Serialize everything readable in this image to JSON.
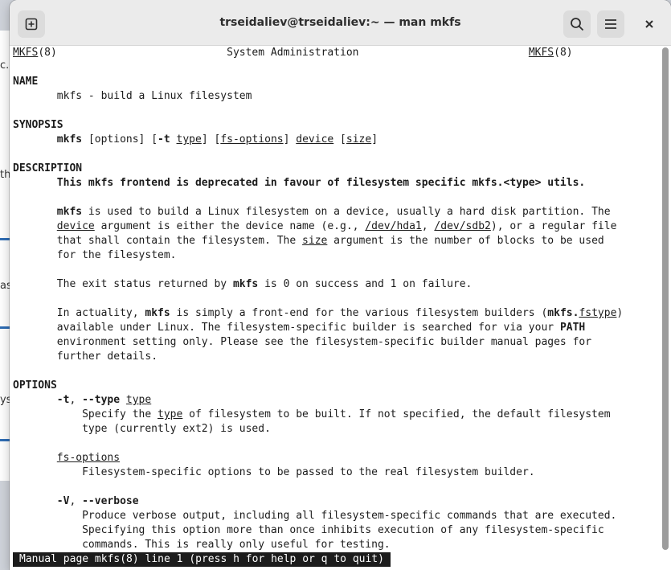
{
  "window": {
    "title": "trseidaliev@trseidaliev:~ — man mkfs"
  },
  "background_fragments": [
    "c.",
    "th",
    "as",
    "ys"
  ],
  "icons": {
    "new_tab": "new-tab-icon",
    "search": "search-icon",
    "menu": "hamburger-menu-icon",
    "close": "close-icon"
  },
  "man": {
    "header_left": "MKFS",
    "header_left_section": "(8)",
    "header_center": "System Administration",
    "header_right": "MKFS",
    "header_right_section": "(8)",
    "name_heading": "NAME",
    "name_text": "mkfs - build a Linux filesystem",
    "synopsis_heading": "SYNOPSIS",
    "synopsis": {
      "cmd": "mkfs",
      "options": "[options]",
      "t_flag": "-t",
      "type": "type",
      "fs_options": "fs-options",
      "device": "device",
      "size": "size"
    },
    "description_heading": "DESCRIPTION",
    "desc_bold": "This mkfs frontend is deprecated in favour of filesystem specific mkfs.<type> utils.",
    "p1": {
      "cmd": "mkfs",
      "l1_rest": " is used to build a Linux filesystem on a device, usually a hard disk partition. The",
      "device": "device",
      "l2_a": " argument is either the device name (e.g., ",
      "dev1": "/dev/hda1",
      "l2_b": ", ",
      "dev2": "/dev/sdb2",
      "l2_c": "), or a regular file",
      "l3_a": "that shall contain the filesystem. The ",
      "size": "size",
      "l3_b": " argument is the number of blocks to be used",
      "l4": "for the filesystem."
    },
    "p2": {
      "a": "The exit status returned by ",
      "cmd": "mkfs",
      "b": " is 0 on success and 1 on failure."
    },
    "p3": {
      "a": "In actuality, ",
      "cmd": "mkfs",
      "b": " is simply a front-end for the various filesystem builders (",
      "mkfs_dot": "mkfs.",
      "fstype": "fstype",
      "c": ")",
      "l2_a": "available under Linux. The filesystem-specific builder is searched for via your ",
      "path": "PATH",
      "l3": "environment setting only. Please see the filesystem-specific builder manual pages for",
      "l4": "further details."
    },
    "options_heading": "OPTIONS",
    "opt_t": {
      "flag_short": "-t",
      "sep": ", ",
      "flag_long": "--type",
      "arg": "type",
      "d1_a": "Specify the ",
      "d1_type": "type",
      "d1_b": " of filesystem to be built. If not specified, the default filesystem",
      "d2": "type (currently ext2) is used."
    },
    "opt_fs": {
      "name": "fs-options",
      "desc": "Filesystem-specific options to be passed to the real filesystem builder."
    },
    "opt_v": {
      "flag_short": "-V",
      "sep": ", ",
      "flag_long": "--verbose",
      "d1": "Produce verbose output, including all filesystem-specific commands that are executed.",
      "d2": "Specifying this option more than once inhibits execution of any filesystem-specific",
      "d3": "commands. This is really only useful for testing."
    }
  },
  "status_line": "Manual page mkfs(8) line 1 (press h for help or q to quit)"
}
